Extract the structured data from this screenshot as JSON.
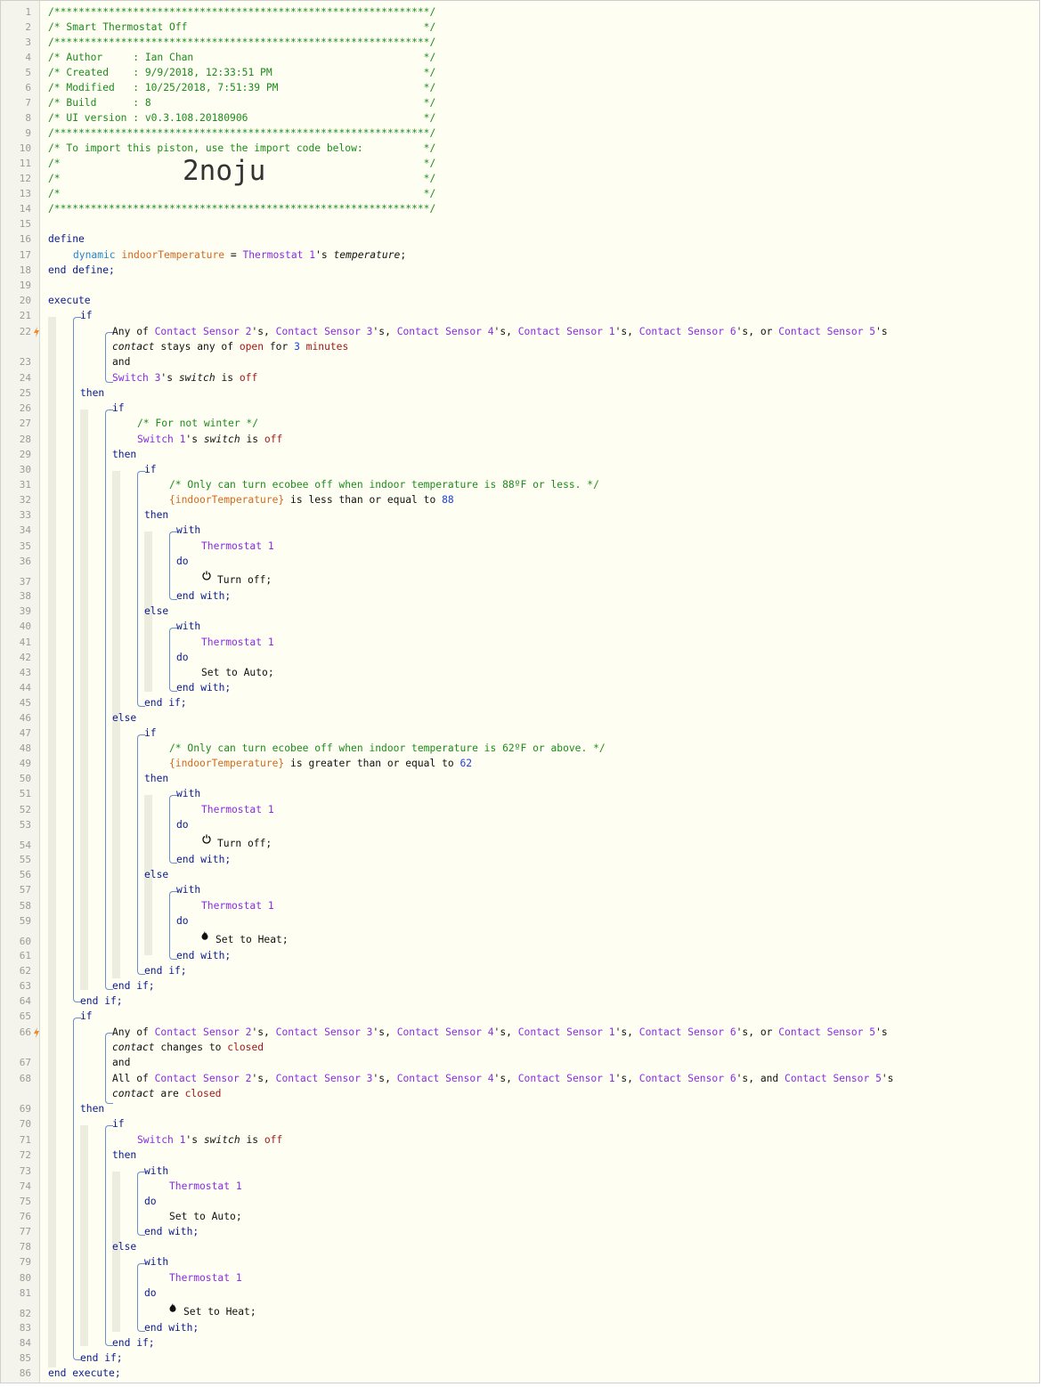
{
  "editor": {
    "lines": [
      {
        "n": 1,
        "text": [
          {
            "c": "comment",
            "t": "/**************************************************************/"
          }
        ]
      },
      {
        "n": 2,
        "text": [
          {
            "c": "comment",
            "t": "/* Smart Thermostat Off                                       */"
          }
        ]
      },
      {
        "n": 3,
        "text": [
          {
            "c": "comment",
            "t": "/**************************************************************/"
          }
        ]
      },
      {
        "n": 4,
        "text": [
          {
            "c": "comment",
            "t": "/* Author     : Ian Chan                                      */"
          }
        ]
      },
      {
        "n": 5,
        "text": [
          {
            "c": "comment",
            "t": "/* Created    : 9/9/2018, 12:33:51 PM                         */"
          }
        ]
      },
      {
        "n": 6,
        "text": [
          {
            "c": "comment",
            "t": "/* Modified   : 10/25/2018, 7:51:39 PM                        */"
          }
        ]
      },
      {
        "n": 7,
        "text": [
          {
            "c": "comment",
            "t": "/* Build      : 8                                             */"
          }
        ]
      },
      {
        "n": 8,
        "text": [
          {
            "c": "comment",
            "t": "/* UI version : v0.3.108.20180906                             */"
          }
        ]
      },
      {
        "n": 9,
        "text": [
          {
            "c": "comment",
            "t": "/**************************************************************/"
          }
        ]
      },
      {
        "n": 10,
        "text": [
          {
            "c": "comment",
            "t": "/* To import this piston, use the import code below:          */"
          }
        ]
      },
      {
        "n": 11,
        "text": [
          {
            "c": "comment",
            "t": "/*                                                            */"
          }
        ]
      },
      {
        "n": 12,
        "text": [
          {
            "c": "comment",
            "t": "/*                                                            */"
          }
        ]
      },
      {
        "n": 13,
        "text": [
          {
            "c": "comment",
            "t": "/*                                                            */"
          }
        ]
      },
      {
        "n": 14,
        "text": [
          {
            "c": "comment",
            "t": "/**************************************************************/"
          }
        ]
      },
      {
        "n": 15,
        "text": []
      },
      {
        "n": 16,
        "text": [
          {
            "c": "kw",
            "t": "define"
          }
        ]
      },
      {
        "n": 17,
        "text": [
          {
            "c": "type",
            "t": "dynamic "
          },
          {
            "c": "var",
            "t": "indoorTemperature"
          },
          {
            "c": "plain",
            "t": " = "
          },
          {
            "c": "dev",
            "t": "Thermostat 1"
          },
          {
            "c": "plain",
            "t": "'s "
          },
          {
            "c": "it",
            "t": "temperature"
          },
          {
            "c": "plain",
            "t": ";"
          }
        ]
      },
      {
        "n": 18,
        "text": [
          {
            "c": "kw",
            "t": "end define;"
          }
        ]
      },
      {
        "n": 19,
        "text": []
      },
      {
        "n": 20,
        "text": [
          {
            "c": "kw",
            "t": "execute"
          }
        ]
      },
      {
        "n": 21,
        "text": [
          {
            "c": "kw",
            "t": "if"
          }
        ]
      },
      {
        "n": 22,
        "text": [
          {
            "c": "plain",
            "t": "Any of "
          },
          {
            "c": "dev",
            "t": "Contact Sensor 2"
          },
          {
            "c": "plain",
            "t": "'s, "
          },
          {
            "c": "dev",
            "t": "Contact Sensor 3"
          },
          {
            "c": "plain",
            "t": "'s, "
          },
          {
            "c": "dev",
            "t": "Contact Sensor 4"
          },
          {
            "c": "plain",
            "t": "'s, "
          },
          {
            "c": "dev",
            "t": "Contact Sensor 1"
          },
          {
            "c": "plain",
            "t": "'s, "
          },
          {
            "c": "dev",
            "t": "Contact Sensor 6"
          },
          {
            "c": "plain",
            "t": "'s, or "
          },
          {
            "c": "dev",
            "t": "Contact Sensor 5"
          },
          {
            "c": "plain",
            "t": "'s"
          }
        ]
      },
      {
        "n": 0,
        "text": [
          {
            "c": "it",
            "t": "contact"
          },
          {
            "c": "plain",
            "t": " stays any of "
          },
          {
            "c": "str",
            "t": "open"
          },
          {
            "c": "plain",
            "t": " for "
          },
          {
            "c": "num",
            "t": "3 "
          },
          {
            "c": "str",
            "t": "minutes"
          }
        ]
      },
      {
        "n": 23,
        "text": [
          {
            "c": "plain",
            "t": "and"
          }
        ]
      },
      {
        "n": 24,
        "text": [
          {
            "c": "dev",
            "t": "Switch 3"
          },
          {
            "c": "plain",
            "t": "'s "
          },
          {
            "c": "it",
            "t": "switch"
          },
          {
            "c": "plain",
            "t": " is "
          },
          {
            "c": "str",
            "t": "off"
          }
        ]
      },
      {
        "n": 25,
        "text": [
          {
            "c": "kw",
            "t": "then"
          }
        ]
      },
      {
        "n": 26,
        "text": [
          {
            "c": "kw",
            "t": "if"
          }
        ]
      },
      {
        "n": 27,
        "text": [
          {
            "c": "comment",
            "t": "/* For not winter */"
          }
        ]
      },
      {
        "n": 28,
        "text": [
          {
            "c": "dev",
            "t": "Switch 1"
          },
          {
            "c": "plain",
            "t": "'s "
          },
          {
            "c": "it",
            "t": "switch"
          },
          {
            "c": "plain",
            "t": " is "
          },
          {
            "c": "str",
            "t": "off"
          }
        ]
      },
      {
        "n": 29,
        "text": [
          {
            "c": "kw",
            "t": "then"
          }
        ]
      },
      {
        "n": 30,
        "text": [
          {
            "c": "kw",
            "t": "if"
          }
        ]
      },
      {
        "n": 31,
        "text": [
          {
            "c": "comment",
            "t": "/* Only can turn ecobee off when indoor temperature is 88ºF or less. */"
          }
        ]
      },
      {
        "n": 32,
        "text": [
          {
            "c": "var",
            "t": "{indoorTemperature}"
          },
          {
            "c": "plain",
            "t": " is less than or equal to "
          },
          {
            "c": "num",
            "t": "88"
          }
        ]
      },
      {
        "n": 33,
        "text": [
          {
            "c": "kw",
            "t": "then"
          }
        ]
      },
      {
        "n": 34,
        "text": [
          {
            "c": "kw",
            "t": "with"
          }
        ]
      },
      {
        "n": 35,
        "text": [
          {
            "c": "dev",
            "t": "Thermostat 1"
          }
        ]
      },
      {
        "n": 36,
        "text": [
          {
            "c": "kw",
            "t": "do"
          }
        ]
      },
      {
        "n": 37,
        "text": [
          {
            "c": "plain",
            "t": "Turn off;"
          }
        ]
      },
      {
        "n": 38,
        "text": [
          {
            "c": "kw",
            "t": "end with;"
          }
        ]
      },
      {
        "n": 39,
        "text": [
          {
            "c": "kw",
            "t": "else"
          }
        ]
      },
      {
        "n": 40,
        "text": [
          {
            "c": "kw",
            "t": "with"
          }
        ]
      },
      {
        "n": 41,
        "text": [
          {
            "c": "dev",
            "t": "Thermostat 1"
          }
        ]
      },
      {
        "n": 42,
        "text": [
          {
            "c": "kw",
            "t": "do"
          }
        ]
      },
      {
        "n": 43,
        "text": [
          {
            "c": "plain",
            "t": "Set to Auto;"
          }
        ]
      },
      {
        "n": 44,
        "text": [
          {
            "c": "kw",
            "t": "end with;"
          }
        ]
      },
      {
        "n": 45,
        "text": [
          {
            "c": "kw",
            "t": "end if;"
          }
        ]
      },
      {
        "n": 46,
        "text": [
          {
            "c": "kw",
            "t": "else"
          }
        ]
      },
      {
        "n": 47,
        "text": [
          {
            "c": "kw",
            "t": "if"
          }
        ]
      },
      {
        "n": 48,
        "text": [
          {
            "c": "comment",
            "t": "/* Only can turn ecobee off when indoor temperature is 62ºF or above. */"
          }
        ]
      },
      {
        "n": 49,
        "text": [
          {
            "c": "var",
            "t": "{indoorTemperature}"
          },
          {
            "c": "plain",
            "t": " is greater than or equal to "
          },
          {
            "c": "num",
            "t": "62"
          }
        ]
      },
      {
        "n": 50,
        "text": [
          {
            "c": "kw",
            "t": "then"
          }
        ]
      },
      {
        "n": 51,
        "text": [
          {
            "c": "kw",
            "t": "with"
          }
        ]
      },
      {
        "n": 52,
        "text": [
          {
            "c": "dev",
            "t": "Thermostat 1"
          }
        ]
      },
      {
        "n": 53,
        "text": [
          {
            "c": "kw",
            "t": "do"
          }
        ]
      },
      {
        "n": 54,
        "text": [
          {
            "c": "plain",
            "t": "Turn off;"
          }
        ]
      },
      {
        "n": 55,
        "text": [
          {
            "c": "kw",
            "t": "end with;"
          }
        ]
      },
      {
        "n": 56,
        "text": [
          {
            "c": "kw",
            "t": "else"
          }
        ]
      },
      {
        "n": 57,
        "text": [
          {
            "c": "kw",
            "t": "with"
          }
        ]
      },
      {
        "n": 58,
        "text": [
          {
            "c": "dev",
            "t": "Thermostat 1"
          }
        ]
      },
      {
        "n": 59,
        "text": [
          {
            "c": "kw",
            "t": "do"
          }
        ]
      },
      {
        "n": 60,
        "text": [
          {
            "c": "plain",
            "t": "Set to Heat;"
          }
        ]
      },
      {
        "n": 61,
        "text": [
          {
            "c": "kw",
            "t": "end with;"
          }
        ]
      },
      {
        "n": 62,
        "text": [
          {
            "c": "kw",
            "t": "end if;"
          }
        ]
      },
      {
        "n": 63,
        "text": [
          {
            "c": "kw",
            "t": "end if;"
          }
        ]
      },
      {
        "n": 64,
        "text": [
          {
            "c": "kw",
            "t": "end if;"
          }
        ]
      },
      {
        "n": 65,
        "text": [
          {
            "c": "kw",
            "t": "if"
          }
        ]
      },
      {
        "n": 66,
        "text": [
          {
            "c": "plain",
            "t": "Any of "
          },
          {
            "c": "dev",
            "t": "Contact Sensor 2"
          },
          {
            "c": "plain",
            "t": "'s, "
          },
          {
            "c": "dev",
            "t": "Contact Sensor 3"
          },
          {
            "c": "plain",
            "t": "'s, "
          },
          {
            "c": "dev",
            "t": "Contact Sensor 4"
          },
          {
            "c": "plain",
            "t": "'s, "
          },
          {
            "c": "dev",
            "t": "Contact Sensor 1"
          },
          {
            "c": "plain",
            "t": "'s, "
          },
          {
            "c": "dev",
            "t": "Contact Sensor 6"
          },
          {
            "c": "plain",
            "t": "'s, or "
          },
          {
            "c": "dev",
            "t": "Contact Sensor 5"
          },
          {
            "c": "plain",
            "t": "'s"
          }
        ]
      },
      {
        "n": 0,
        "text": [
          {
            "c": "it",
            "t": "contact"
          },
          {
            "c": "plain",
            "t": " changes to "
          },
          {
            "c": "str",
            "t": "closed"
          }
        ]
      },
      {
        "n": 67,
        "text": [
          {
            "c": "plain",
            "t": "and"
          }
        ]
      },
      {
        "n": 68,
        "text": [
          {
            "c": "plain",
            "t": "All of "
          },
          {
            "c": "dev",
            "t": "Contact Sensor 2"
          },
          {
            "c": "plain",
            "t": "'s, "
          },
          {
            "c": "dev",
            "t": "Contact Sensor 3"
          },
          {
            "c": "plain",
            "t": "'s, "
          },
          {
            "c": "dev",
            "t": "Contact Sensor 4"
          },
          {
            "c": "plain",
            "t": "'s, "
          },
          {
            "c": "dev",
            "t": "Contact Sensor 1"
          },
          {
            "c": "plain",
            "t": "'s, "
          },
          {
            "c": "dev",
            "t": "Contact Sensor 6"
          },
          {
            "c": "plain",
            "t": "'s, and "
          },
          {
            "c": "dev",
            "t": "Contact Sensor 5"
          },
          {
            "c": "plain",
            "t": "'s"
          }
        ]
      },
      {
        "n": 0,
        "text": [
          {
            "c": "it",
            "t": "contact"
          },
          {
            "c": "plain",
            "t": " are "
          },
          {
            "c": "str",
            "t": "closed"
          }
        ]
      },
      {
        "n": 69,
        "text": [
          {
            "c": "kw",
            "t": "then"
          }
        ]
      },
      {
        "n": 70,
        "text": [
          {
            "c": "kw",
            "t": "if"
          }
        ]
      },
      {
        "n": 71,
        "text": [
          {
            "c": "dev",
            "t": "Switch 1"
          },
          {
            "c": "plain",
            "t": "'s "
          },
          {
            "c": "it",
            "t": "switch"
          },
          {
            "c": "plain",
            "t": " is "
          },
          {
            "c": "str",
            "t": "off"
          }
        ]
      },
      {
        "n": 72,
        "text": [
          {
            "c": "kw",
            "t": "then"
          }
        ]
      },
      {
        "n": 73,
        "text": [
          {
            "c": "kw",
            "t": "with"
          }
        ]
      },
      {
        "n": 74,
        "text": [
          {
            "c": "dev",
            "t": "Thermostat 1"
          }
        ]
      },
      {
        "n": 75,
        "text": [
          {
            "c": "kw",
            "t": "do"
          }
        ]
      },
      {
        "n": 76,
        "text": [
          {
            "c": "plain",
            "t": "Set to Auto;"
          }
        ]
      },
      {
        "n": 77,
        "text": [
          {
            "c": "kw",
            "t": "end with;"
          }
        ]
      },
      {
        "n": 78,
        "text": [
          {
            "c": "kw",
            "t": "else"
          }
        ]
      },
      {
        "n": 79,
        "text": [
          {
            "c": "kw",
            "t": "with"
          }
        ]
      },
      {
        "n": 80,
        "text": [
          {
            "c": "dev",
            "t": "Thermostat 1"
          }
        ]
      },
      {
        "n": 81,
        "text": [
          {
            "c": "kw",
            "t": "do"
          }
        ]
      },
      {
        "n": 82,
        "text": [
          {
            "c": "plain",
            "t": "Set to Heat;"
          }
        ]
      },
      {
        "n": 83,
        "text": [
          {
            "c": "kw",
            "t": "end with;"
          }
        ]
      },
      {
        "n": 84,
        "text": [
          {
            "c": "kw",
            "t": "end if;"
          }
        ]
      },
      {
        "n": 85,
        "text": [
          {
            "c": "kw",
            "t": "end if;"
          }
        ]
      },
      {
        "n": 86,
        "text": [
          {
            "c": "kw",
            "t": "end execute;"
          }
        ]
      }
    ],
    "import_code": "2noju",
    "trigger_lines": [
      22,
      66
    ],
    "icons": {
      "37": "power-icon",
      "54": "power-icon",
      "60": "flame-icon",
      "82": "flame-icon"
    }
  }
}
